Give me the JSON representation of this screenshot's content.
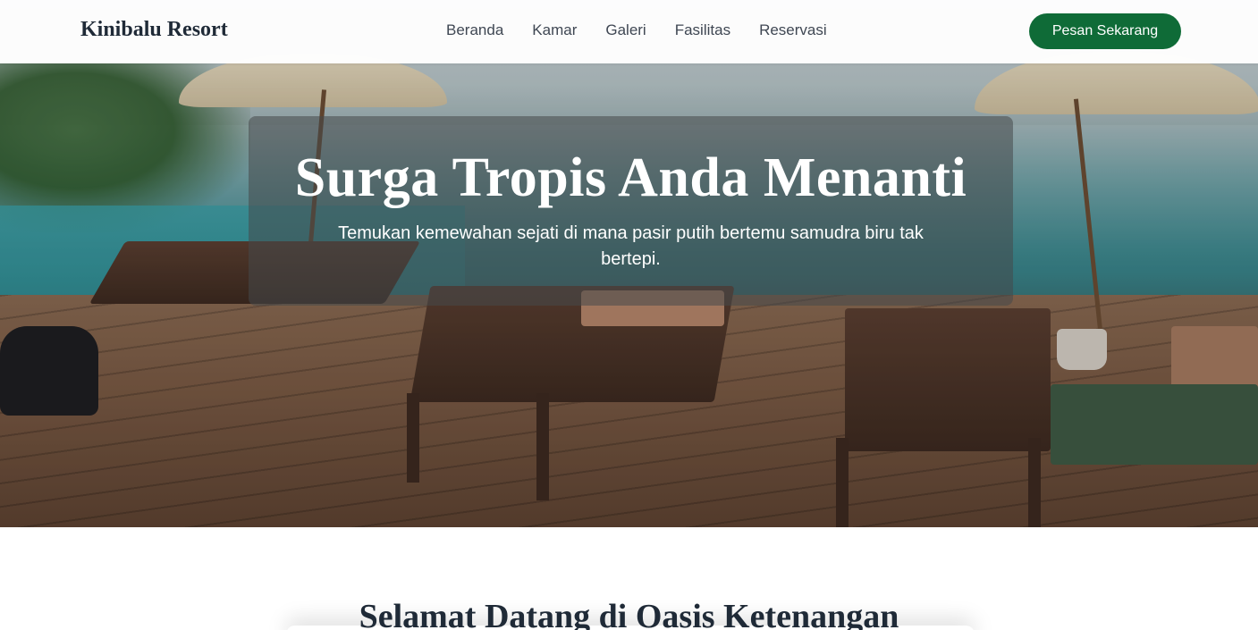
{
  "navbar": {
    "brand": "Kinibalu Resort",
    "links": [
      "Beranda",
      "Kamar",
      "Galeri",
      "Fasilitas",
      "Reservasi"
    ],
    "cta_label": "Pesan Sekarang",
    "cta_color": "#0f6b37"
  },
  "hero": {
    "title": "Surga Tropis Anda Menanti",
    "subtitle": "Temukan kemewahan sejati di mana pasir putih bertemu samudra biru tak bertepi."
  },
  "welcome": {
    "title": "Selamat Datang di Oasis Ketenangan"
  }
}
